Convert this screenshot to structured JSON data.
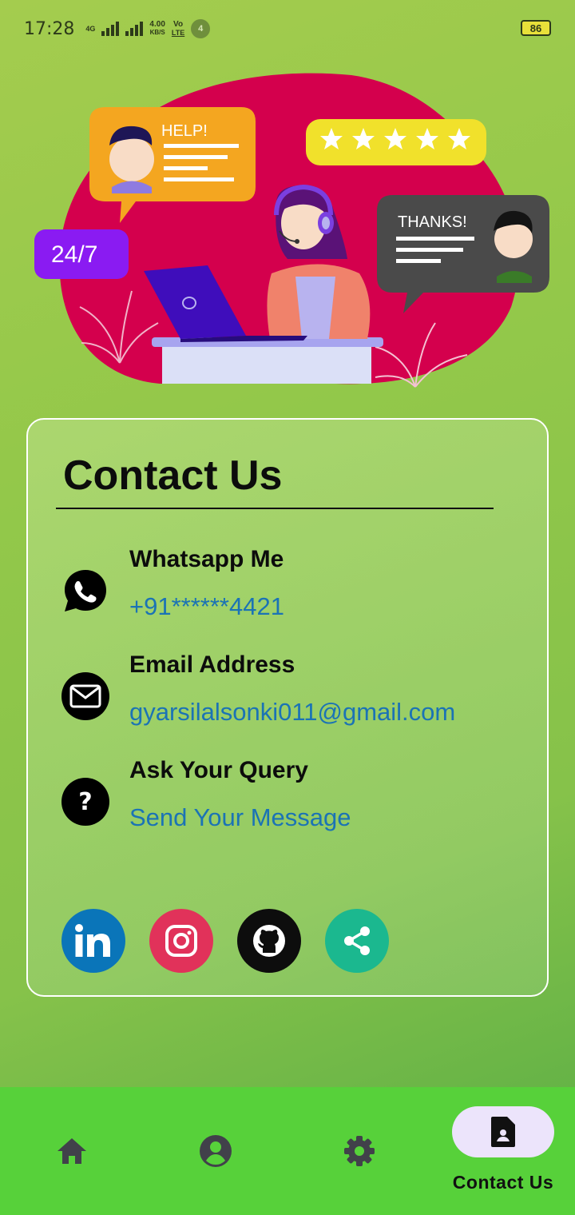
{
  "status_bar": {
    "time": "17:28",
    "network_label": "4G",
    "speed_value": "4.00",
    "speed_unit": "KB/S",
    "volte_top": "Vo",
    "volte_bottom": "LTE",
    "notification_count": "4",
    "battery": "86"
  },
  "hero": {
    "help_text": "HELP!",
    "thanks_text": "THANKS!",
    "availability_text": "24/7",
    "rating_stars": 5
  },
  "contact_card": {
    "title": "Contact Us",
    "items": [
      {
        "label": "Whatsapp Me",
        "value": "+91******4421",
        "icon": "whatsapp-icon"
      },
      {
        "label": "Email Address",
        "value": "gyarsilalsonki011@gmail.com",
        "icon": "mail-icon"
      },
      {
        "label": "Ask Your Query",
        "value": "Send Your Message",
        "icon": "question-icon"
      }
    ],
    "social": [
      {
        "name": "linkedin",
        "color": "#0a75b9"
      },
      {
        "name": "instagram",
        "color": "#e1325a"
      },
      {
        "name": "github",
        "color": "#0d0d0d"
      },
      {
        "name": "share",
        "color": "#1bb88f"
      }
    ]
  },
  "bottom_nav": {
    "items": [
      {
        "icon": "home-icon",
        "label": ""
      },
      {
        "icon": "account-icon",
        "label": ""
      },
      {
        "icon": "settings-icon",
        "label": ""
      },
      {
        "icon": "contact-icon",
        "label": "Contact Us",
        "active": true
      }
    ]
  }
}
